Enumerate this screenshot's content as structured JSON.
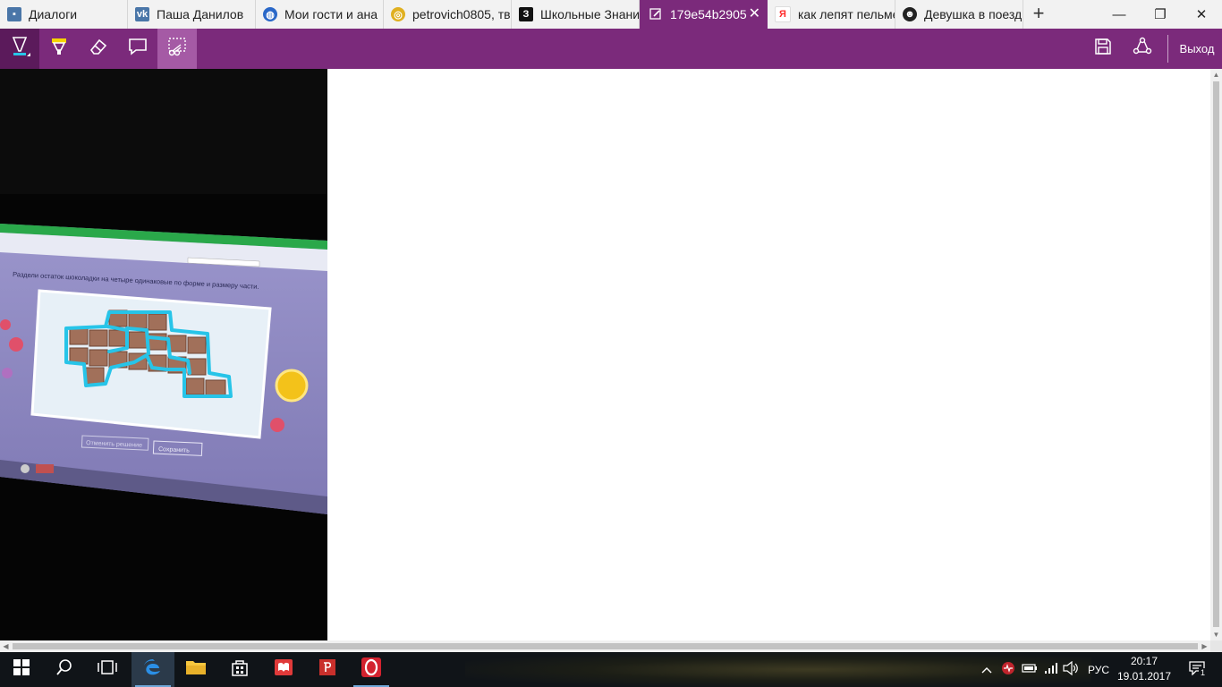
{
  "tabs": [
    {
      "title": "Диалоги",
      "icon": "chat-icon",
      "color": "#4a76a8"
    },
    {
      "title": "Паша Данилов",
      "icon": "vk-icon",
      "color": "#4a76a8"
    },
    {
      "title": "Мои гости и ана",
      "icon": "globe-icon",
      "color": "#2a68c8"
    },
    {
      "title": "petrovich0805, тв",
      "icon": "circle-icon",
      "color": "#1e88b8"
    },
    {
      "title": "Школьные Знани",
      "icon": "znanija-icon",
      "color": "#111111"
    },
    {
      "title": "179e54b2905",
      "icon": "pen-icon",
      "color": "#ffffff",
      "active": true
    },
    {
      "title": "как лепят пельме",
      "icon": "yandex-icon",
      "color": "#ff2b2b"
    },
    {
      "title": "Девушка в поезд",
      "icon": "face-icon",
      "color": "#222222"
    }
  ],
  "window_controls": {
    "minimize": "—",
    "restore": "❐",
    "close": "✕"
  },
  "ink_toolbar": {
    "tools": [
      "ballpoint-pen",
      "highlighter",
      "eraser",
      "add-note",
      "clip"
    ],
    "selected": "ballpoint-pen",
    "active_clip": "clip",
    "exit_label": "Выход"
  },
  "photo": {
    "instruction": "Раздели остаток шоколадки на четыре одинаковые по форме и размеру части.",
    "url": "Search",
    "btn_reset": "Отменить решение",
    "btn_save": "Сохранить",
    "accent_color": "#27c4e8",
    "screen_color": "#8c86c0"
  },
  "tray": {
    "language": "РУС",
    "time": "20:17",
    "date": "19.01.2017",
    "notifications": "1"
  },
  "colors": {
    "accent": "#7b2a7b",
    "taskbar": "#101418"
  }
}
